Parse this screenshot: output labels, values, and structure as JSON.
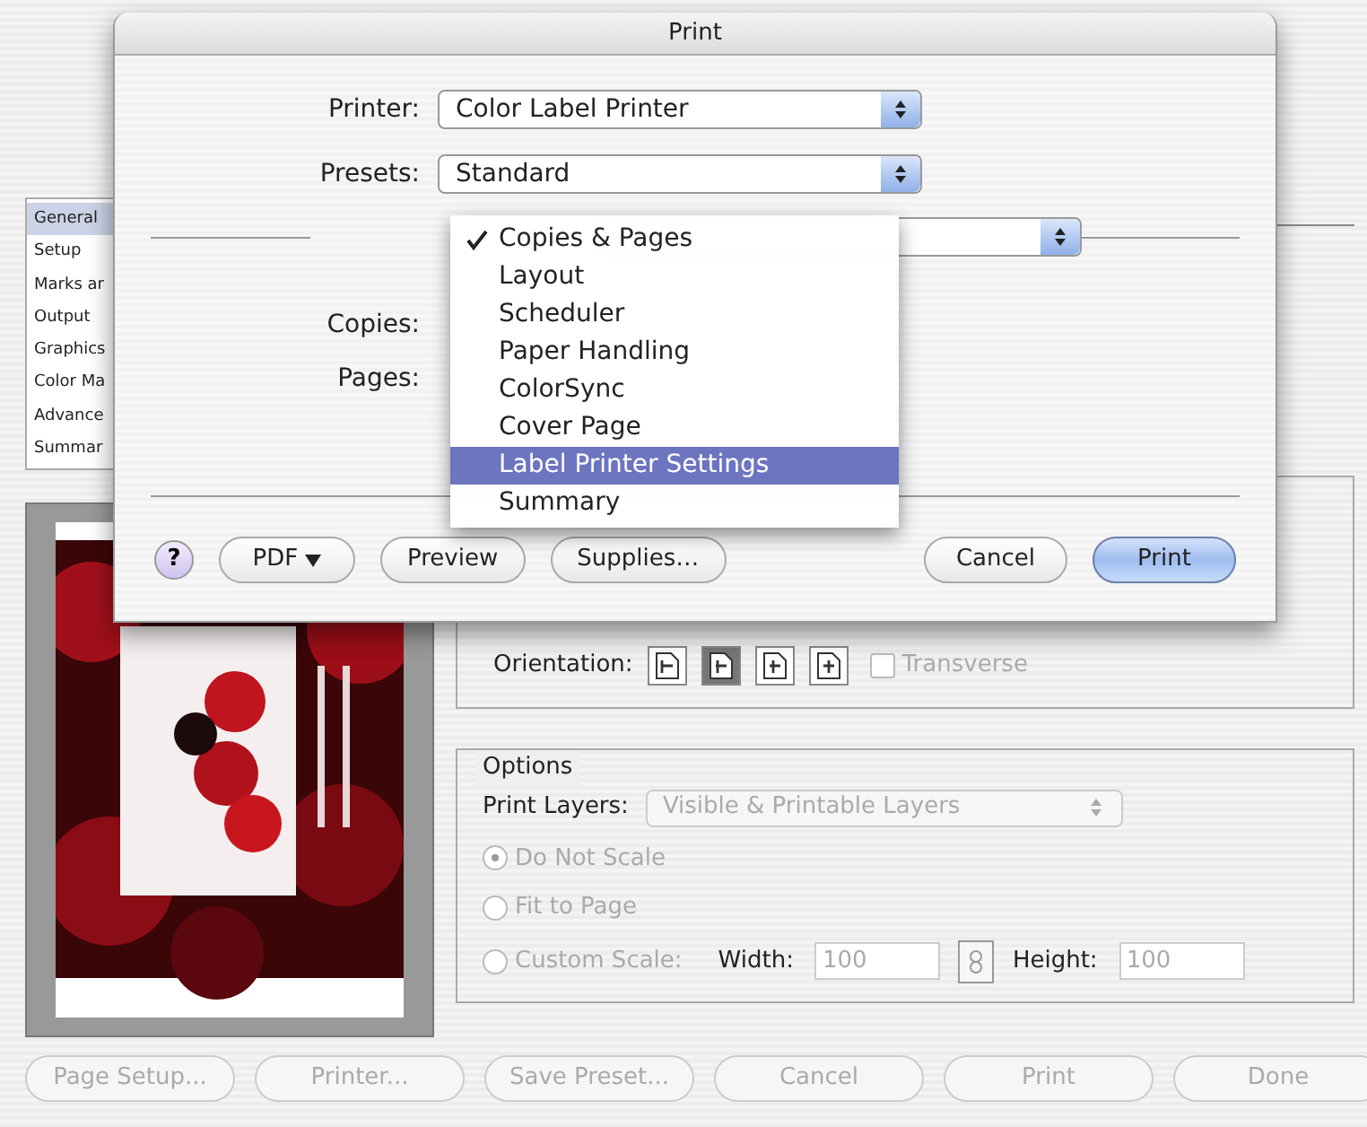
{
  "background_window": {
    "sidebar": {
      "items": [
        {
          "label": "General",
          "selected": true
        },
        {
          "label": "Setup",
          "selected": false
        },
        {
          "label": "Marks ar",
          "selected": false
        },
        {
          "label": "Output",
          "selected": false
        },
        {
          "label": "Graphics",
          "selected": false
        },
        {
          "label": "Color Ma",
          "selected": false
        },
        {
          "label": "Advance",
          "selected": false
        },
        {
          "label": "Summar",
          "selected": false
        }
      ]
    },
    "orientation": {
      "label": "Orientation:",
      "options": [
        {
          "selected": false
        },
        {
          "selected": true
        },
        {
          "selected": false
        },
        {
          "selected": false
        }
      ],
      "transverse": {
        "label": "Transverse",
        "checked": false,
        "disabled": true
      }
    },
    "options": {
      "title": "Options",
      "print_layers": {
        "label": "Print Layers:",
        "value": "Visible & Printable Layers",
        "disabled": true
      },
      "scale": [
        {
          "label": "Do Not Scale",
          "selected": true,
          "disabled": true
        },
        {
          "label": "Fit to Page",
          "selected": false,
          "disabled": true
        },
        {
          "label": "Custom Scale:",
          "selected": false,
          "disabled": true
        }
      ],
      "width": {
        "label": "Width:",
        "value": "100"
      },
      "height": {
        "label": "Height:",
        "value": "100"
      }
    },
    "buttons": [
      {
        "label": "Page Setup...",
        "disabled": true
      },
      {
        "label": "Printer...",
        "disabled": true
      },
      {
        "label": "Save Preset...",
        "disabled": true
      },
      {
        "label": "Cancel",
        "disabled": true
      },
      {
        "label": "Print",
        "disabled": true
      },
      {
        "label": "Done",
        "disabled": true
      }
    ]
  },
  "dialog": {
    "title": "Print",
    "printer": {
      "label": "Printer:",
      "value": "Color Label Printer"
    },
    "presets": {
      "label": "Presets:",
      "value": "Standard"
    },
    "copies_label": "Copies:",
    "pages_label": "Pages:",
    "menu": {
      "items": [
        {
          "label": "Copies & Pages",
          "checked": true,
          "selected": false
        },
        {
          "label": "Layout",
          "checked": false,
          "selected": false
        },
        {
          "label": "Scheduler",
          "checked": false,
          "selected": false
        },
        {
          "label": "Paper Handling",
          "checked": false,
          "selected": false
        },
        {
          "label": "ColorSync",
          "checked": false,
          "selected": false
        },
        {
          "label": "Cover Page",
          "checked": false,
          "selected": false
        },
        {
          "label": "Label Printer Settings",
          "checked": false,
          "selected": true
        },
        {
          "label": "Summary",
          "checked": false,
          "selected": false
        }
      ]
    },
    "buttons": [
      {
        "kind": "help",
        "label": "?"
      },
      {
        "kind": "menu",
        "label": "PDF"
      },
      {
        "kind": "push",
        "label": "Preview",
        "default": false
      },
      {
        "kind": "push",
        "label": "Supplies…",
        "default": false
      },
      {
        "kind": "gap"
      },
      {
        "kind": "push",
        "label": "Cancel",
        "default": false
      },
      {
        "kind": "push",
        "label": "Print",
        "default": true
      }
    ]
  }
}
